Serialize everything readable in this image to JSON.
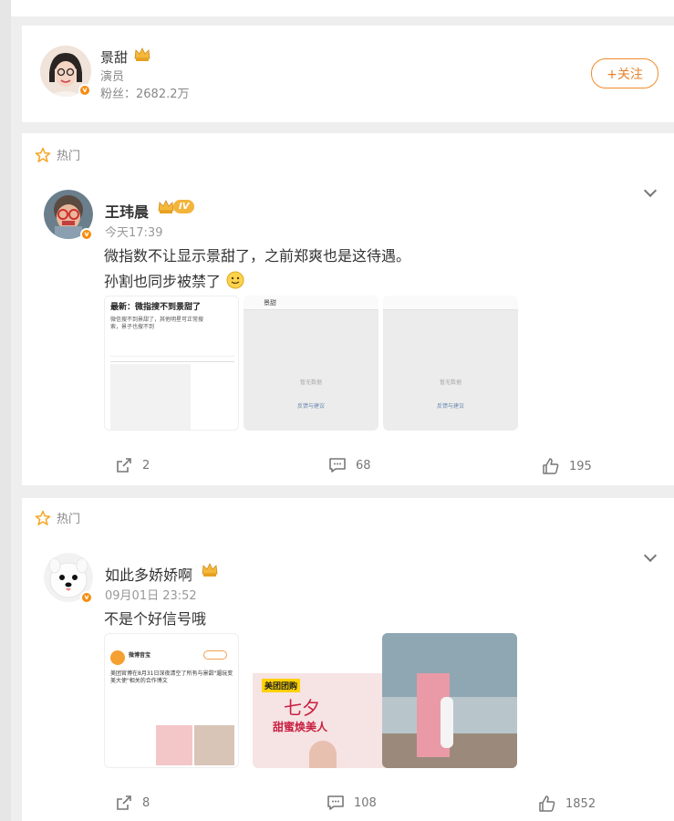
{
  "profile": {
    "name": "景甜",
    "role": "演员",
    "followers": "粉丝：2682.2万",
    "follow_label": "+关注"
  },
  "posts": [
    {
      "hot_label": "热门",
      "author": "王玮晨",
      "level": "IV",
      "time": "今天17:39",
      "lines": [
        "微指数不让显示景甜了，之前郑爽也是这待遇。",
        "孙割也同步被禁了"
      ],
      "images": [
        {
          "title": "最新：微指搜不到景甜了",
          "body": "微信搜不到景甜了，其他明星可正常搜索，景子也搜不到"
        },
        {
          "header": "景甜",
          "empty": "暂无数据",
          "link": "反馈与建议"
        },
        {
          "empty": "暂无数据",
          "link": "反馈与建议"
        }
      ],
      "reposts": "2",
      "comments": "68",
      "likes": "195"
    },
    {
      "hot_label": "热门",
      "author": "如此多娇娇啊",
      "time": "09月01日 23:52",
      "lines": [
        "不是个好信号哦"
      ],
      "images": [
        {
          "account": "微博音宝",
          "text": "美团官博在8月31日深夜清空了所有与景甜\"遛玩变美大使\"相关的合作博文"
        },
        {
          "brand": "美团团购",
          "headline": "七夕",
          "sub": "甜蜜焕美人"
        },
        {
          "desc": "store-photo"
        }
      ],
      "reposts": "8",
      "comments": "108",
      "likes": "1852"
    }
  ],
  "colors": {
    "accent": "#f08c2a",
    "verified": "#f78c0d",
    "star": "#f5a623"
  },
  "icons": [
    "repost-icon",
    "comment-icon",
    "like-icon",
    "star-icon",
    "chevron-down-icon",
    "crown-icon"
  ]
}
